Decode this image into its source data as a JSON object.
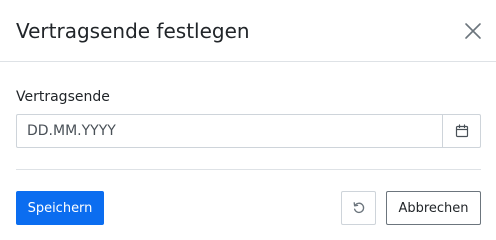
{
  "dialog": {
    "title": "Vertragsende festlegen",
    "close_icon": "close-icon"
  },
  "form": {
    "field_label": "Vertragsende",
    "date_placeholder": "DD.MM.YYYY",
    "date_value": "",
    "calendar_icon": "calendar-icon"
  },
  "footer": {
    "save_label": "Speichern",
    "reset_icon": "reset-icon",
    "cancel_label": "Abbrechen"
  },
  "colors": {
    "primary": "#0b6df0",
    "border": "#ced4da",
    "divider": "#dee2e6",
    "text": "#212529",
    "muted_icon": "#6c757d"
  }
}
